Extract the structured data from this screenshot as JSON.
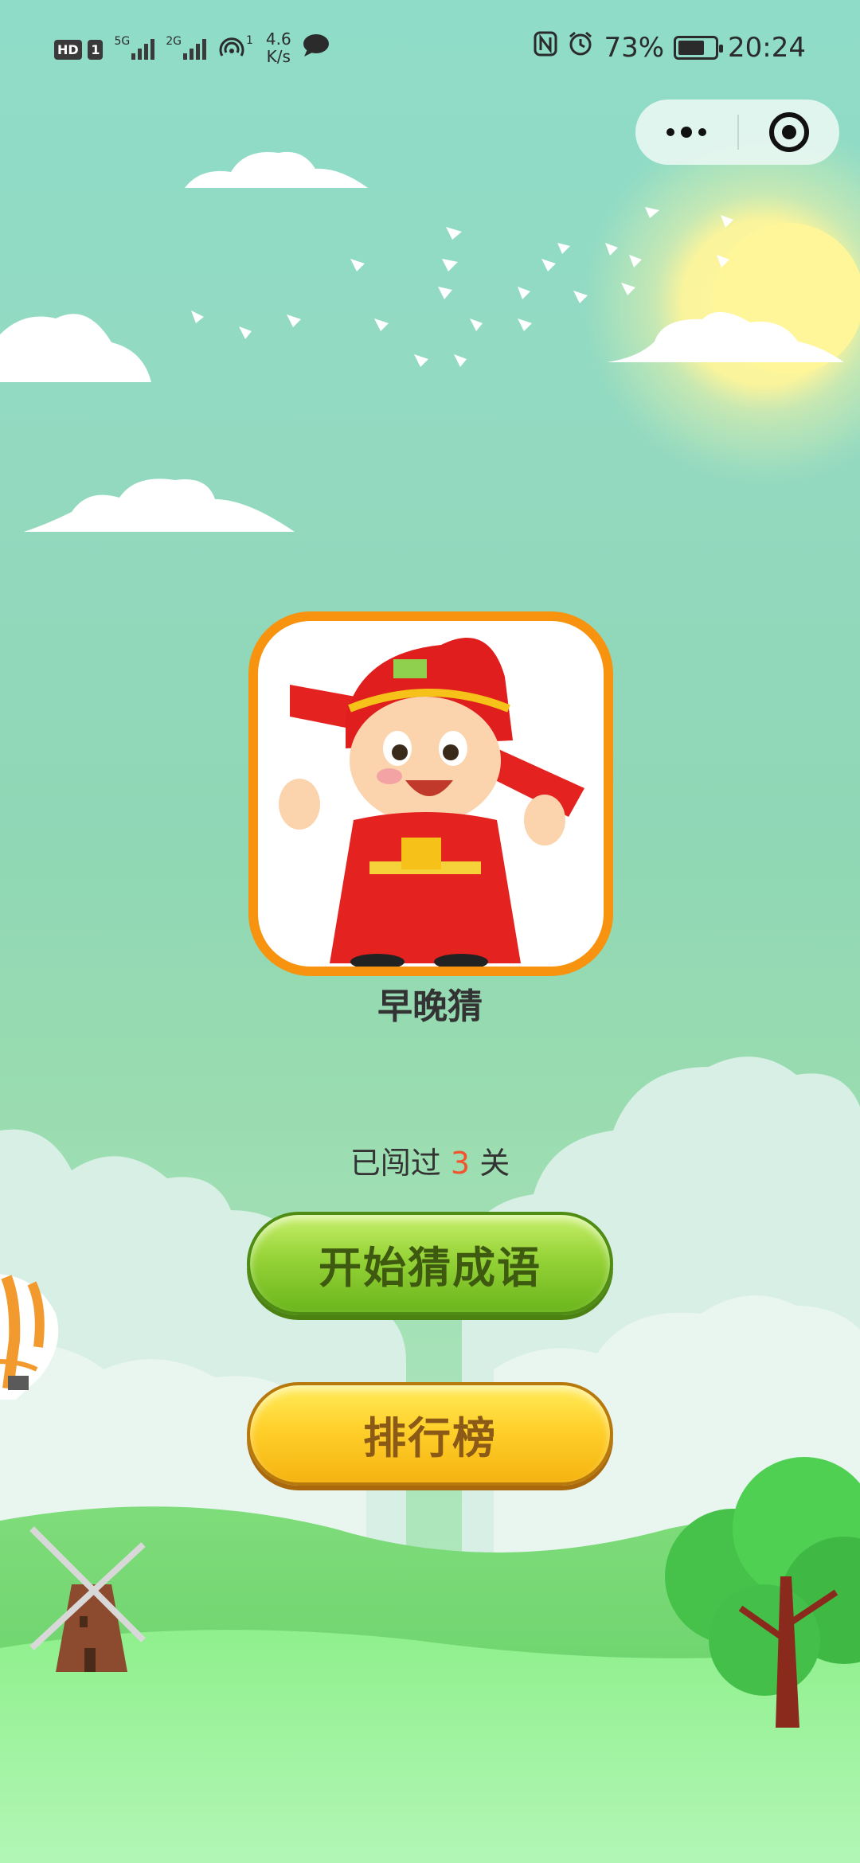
{
  "status_bar": {
    "hd_label": "HD",
    "sim1_label": "1",
    "net1_label": "5G",
    "net2_label": "2G",
    "hotspot_count": "1",
    "speed_value": "4.6",
    "speed_unit": "K/s",
    "battery_percent": "73%",
    "battery_level": 0.73,
    "time": "20:24"
  },
  "capsule": {
    "more_icon": "more-dots-icon",
    "close_icon": "target-close-icon"
  },
  "app": {
    "name": "早晚猜",
    "progress_prefix": "已闯过",
    "progress_count": "3",
    "progress_suffix": "关"
  },
  "buttons": {
    "start_label": "开始猜成语",
    "rank_label": "排行榜"
  },
  "colors": {
    "logo_border": "#f7930f",
    "start_button": "#95d337",
    "rank_button": "#ffd02b",
    "progress_count": "#f2542d"
  }
}
